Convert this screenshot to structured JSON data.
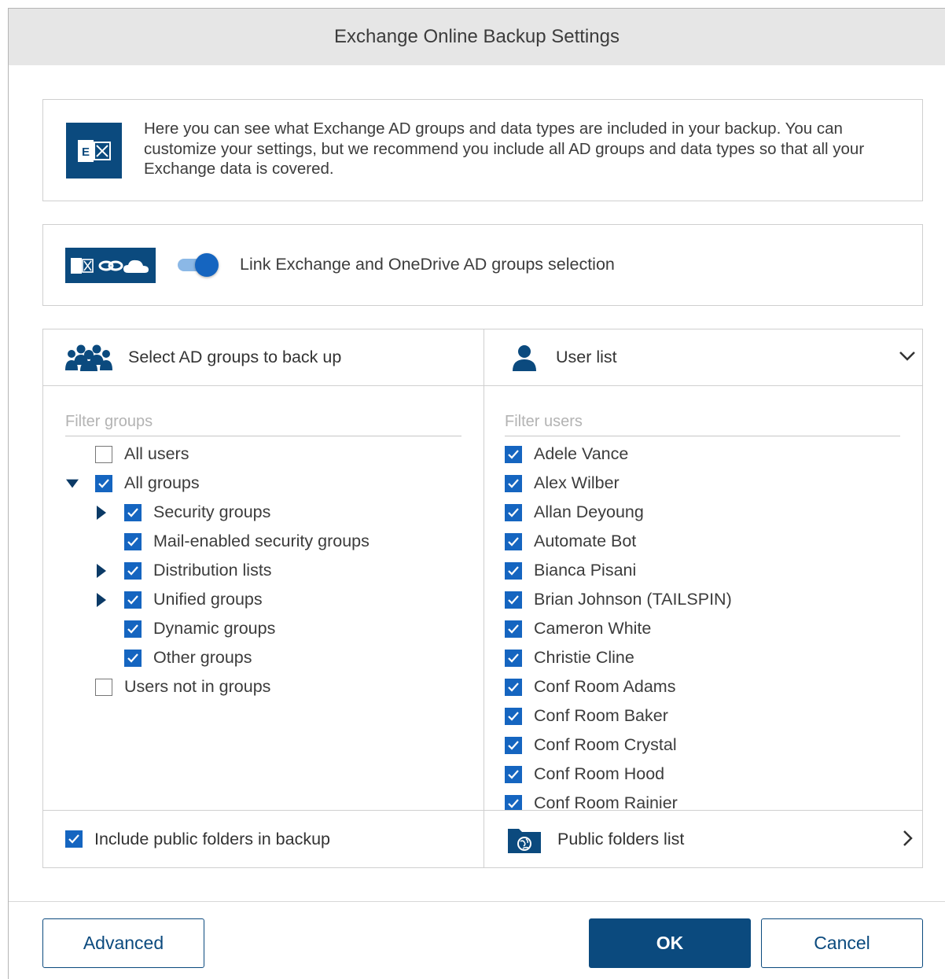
{
  "dialog": {
    "title": "Exchange Online Backup Settings"
  },
  "info": {
    "icon": "exchange-logo-icon",
    "logo_text": "E",
    "text": "Here you can see what Exchange AD groups and data types are included in your backup. You can customize your settings, but we recommend you include all AD groups and data types so that all your Exchange data is covered."
  },
  "link": {
    "icon": "exchange-onedrive-link-icon",
    "toggle_on": true,
    "label": "Link Exchange and OneDrive AD groups selection"
  },
  "groups_panel": {
    "icon": "groups-icon",
    "title": "Select AD groups to back up",
    "filter_placeholder": "Filter groups",
    "items": [
      {
        "label": "All users",
        "checked": false,
        "level": 0,
        "expander": "none"
      },
      {
        "label": "All groups",
        "checked": true,
        "level": 0,
        "expander": "expanded"
      },
      {
        "label": "Security groups",
        "checked": true,
        "level": 1,
        "expander": "collapsed"
      },
      {
        "label": "Mail-enabled security groups",
        "checked": true,
        "level": 1,
        "expander": "none"
      },
      {
        "label": "Distribution lists",
        "checked": true,
        "level": 1,
        "expander": "collapsed"
      },
      {
        "label": "Unified groups",
        "checked": true,
        "level": 1,
        "expander": "collapsed"
      },
      {
        "label": "Dynamic groups",
        "checked": true,
        "level": 1,
        "expander": "none"
      },
      {
        "label": "Other groups",
        "checked": true,
        "level": 1,
        "expander": "none"
      },
      {
        "label": "Users not in groups",
        "checked": false,
        "level": 0,
        "expander": "none"
      }
    ]
  },
  "users_panel": {
    "icon": "user-icon",
    "title": "User list",
    "collapse_icon": "chevron-down-icon",
    "filter_placeholder": "Filter users",
    "users": [
      {
        "name": "Adele Vance",
        "checked": true
      },
      {
        "name": "Alex Wilber",
        "checked": true
      },
      {
        "name": "Allan Deyoung",
        "checked": true
      },
      {
        "name": "Automate Bot",
        "checked": true
      },
      {
        "name": "Bianca Pisani",
        "checked": true
      },
      {
        "name": "Brian Johnson (TAILSPIN)",
        "checked": true
      },
      {
        "name": "Cameron White",
        "checked": true
      },
      {
        "name": "Christie Cline",
        "checked": true
      },
      {
        "name": "Conf Room Adams",
        "checked": true
      },
      {
        "name": "Conf Room Baker",
        "checked": true
      },
      {
        "name": "Conf Room Crystal",
        "checked": true
      },
      {
        "name": "Conf Room Hood",
        "checked": true
      },
      {
        "name": "Conf Room Rainier",
        "checked": true
      }
    ]
  },
  "public_folders": {
    "include_label": "Include public folders in backup",
    "include_checked": true,
    "icon": "public-folder-icon",
    "list_title": "Public folders list",
    "open_icon": "chevron-right-icon"
  },
  "buttons": {
    "advanced": "Advanced",
    "ok": "OK",
    "cancel": "Cancel"
  },
  "colors": {
    "accent": "#1565c0",
    "brand_dark": "#0b4a7e",
    "titlebar": "#e6e6e6"
  }
}
